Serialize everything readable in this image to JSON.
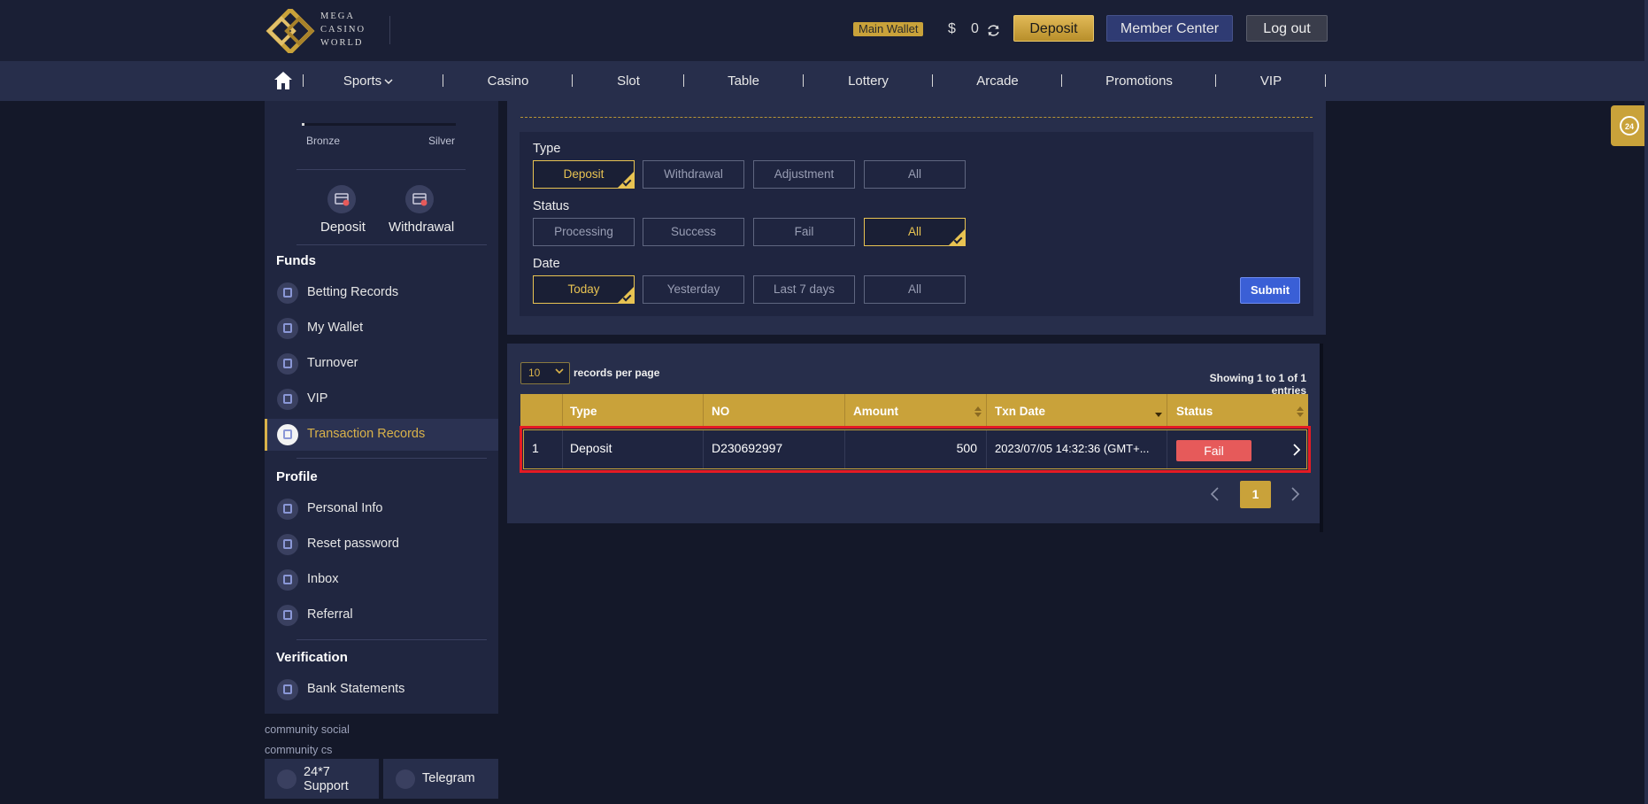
{
  "brand": {
    "logo_text": "MEGA CASINO WORLD",
    "logo_lines": [
      "MEGA",
      "CASINO",
      "WORLD"
    ]
  },
  "header": {
    "wallet_label": "Main Wallet",
    "currency": "$",
    "balance": "0",
    "deposit_label": "Deposit",
    "member_center_label": "Member Center",
    "logout_label": "Log out"
  },
  "nav": {
    "items": [
      "Sports",
      "Casino",
      "Slot",
      "Table",
      "Lottery",
      "Arcade",
      "Promotions",
      "VIP"
    ]
  },
  "sidebar": {
    "level": {
      "current": "Bronze",
      "next": "Silver",
      "progress": 0.02
    },
    "quick_actions": [
      "Deposit",
      "Withdrawal"
    ],
    "funds_title": "Funds",
    "funds_items": [
      "Betting Records",
      "My Wallet",
      "Turnover",
      "VIP",
      "Transaction Records"
    ],
    "profile_title": "Profile",
    "profile_items": [
      "Personal Info",
      "Reset password",
      "Inbox",
      "Referral"
    ],
    "verification_title": "Verification",
    "verification_items": [
      "Bank Statements"
    ],
    "community_social": "community social",
    "community_cs": "community cs",
    "support_label_1": "24*7",
    "support_label_2": "Support",
    "telegram_label": "Telegram"
  },
  "filters": {
    "type_label": "Type",
    "type_options": [
      "Deposit",
      "Withdrawal",
      "Adjustment",
      "All"
    ],
    "type_selected": "Deposit",
    "status_label": "Status",
    "status_options": [
      "Processing",
      "Success",
      "Fail",
      "All"
    ],
    "status_selected": "All",
    "date_label": "Date",
    "date_options": [
      "Today",
      "Yesterday",
      "Last 7 days",
      "All"
    ],
    "date_selected": "Today",
    "submit_label": "Submit"
  },
  "table": {
    "per_page": "10",
    "per_page_label": "records per page",
    "entries_text": "Showing 1 to 1 of 1 entries",
    "columns": [
      "",
      "Type",
      "NO",
      "Amount",
      "Txn Date",
      "Status"
    ],
    "rows": [
      {
        "index": "1",
        "type": "Deposit",
        "no": "D230692997",
        "amount": "500",
        "txn_date": "2023/07/05 14:32:36 (GMT+...",
        "status": "Fail"
      }
    ],
    "current_page": "1"
  },
  "colors": {
    "accent_gold": "#c9a23a",
    "fail_red": "#e65a5a",
    "highlight_red": "#e51b23",
    "submit_blue": "#3a5fd6"
  }
}
